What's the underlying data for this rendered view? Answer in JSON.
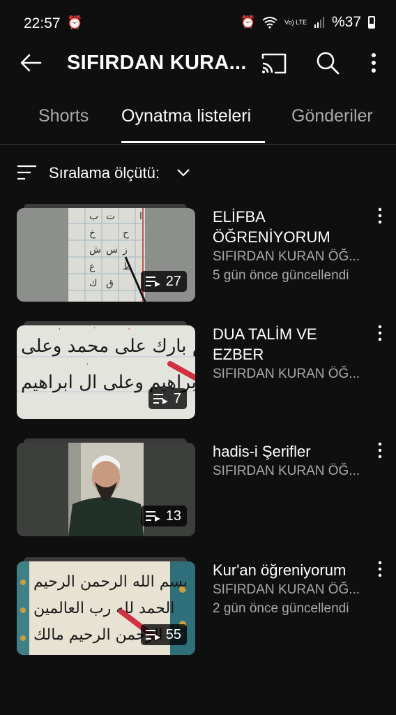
{
  "status_bar": {
    "time": "22:57",
    "battery": "%37",
    "network": "Vo) LTE"
  },
  "app_bar": {
    "title": "SIFIRDAN KURA..."
  },
  "tabs": [
    {
      "label": "Shorts",
      "active": false
    },
    {
      "label": "Oynatma listeleri",
      "active": true
    },
    {
      "label": "Gönderiler",
      "active": false
    }
  ],
  "sort": {
    "label": "Sıralama ölçütü:"
  },
  "playlists": [
    {
      "title": "ELİFBA ÖĞRENİYORUM",
      "channel": "SIFIRDAN KURAN ÖĞ...",
      "updated": "5 gün önce güncellendi",
      "count": "27"
    },
    {
      "title": "DUA TALİM VE EZBER",
      "channel": "SIFIRDAN KURAN ÖĞ...",
      "updated": "",
      "count": "7"
    },
    {
      "title": "hadis-i Şerifler",
      "channel": "SIFIRDAN KURAN ÖĞ...",
      "updated": "",
      "count": "13"
    },
    {
      "title": "Kur'an öğreniyorum",
      "channel": "SIFIRDAN KURAN ÖĞ...",
      "updated": "2 gün önce güncellendi",
      "count": "55"
    }
  ]
}
